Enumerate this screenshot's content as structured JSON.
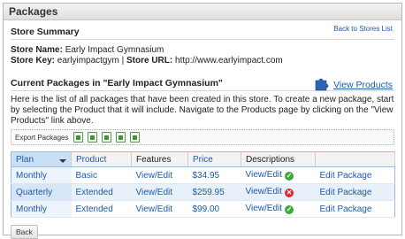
{
  "panel": {
    "title": "Packages"
  },
  "store_summary": {
    "heading": "Store Summary",
    "back_link": "Back to Stores List",
    "name_label": "Store Name:",
    "name_value": "Early Impact Gymnasium",
    "key_label": "Store Key:",
    "key_value": "earlyimpactgym",
    "separator": "|",
    "url_label": "Store URL:",
    "url_value": "http://www.earlyimpact.com"
  },
  "current_packages": {
    "heading": "Current Packages in \"Early Impact Gymnasium\"",
    "view_products": "View Products",
    "description": "Here is the list of all packages that have been created in this store. To create a new package, start by selecting the Product that it will include. Navigate to the Products page by clicking on the \"View Products\" link above.",
    "export_label": "Export Packages"
  },
  "table": {
    "columns": [
      "Plan",
      "Product",
      "Features",
      "Price",
      "Descriptions",
      ""
    ],
    "rows": [
      {
        "plan": "Monthly",
        "product": "Basic",
        "features": "View/Edit",
        "price": "$34.95",
        "descriptions": "View/Edit",
        "status": "ok",
        "action": "Edit Package"
      },
      {
        "plan": "Quarterly",
        "product": "Extended",
        "features": "View/Edit",
        "price": "$259.95",
        "descriptions": "View/Edit",
        "status": "error",
        "action": "Edit Package"
      },
      {
        "plan": "Monthly",
        "product": "Extended",
        "features": "View/Edit",
        "price": "$99.00",
        "descriptions": "View/Edit",
        "status": "ok",
        "action": "Edit Package"
      }
    ]
  },
  "footer": {
    "back_button": "Back"
  },
  "colors": {
    "link": "#1d5aa7",
    "sorted_header": "#c9dff5",
    "ok": "#3ba83a",
    "error": "#d62b2b"
  }
}
